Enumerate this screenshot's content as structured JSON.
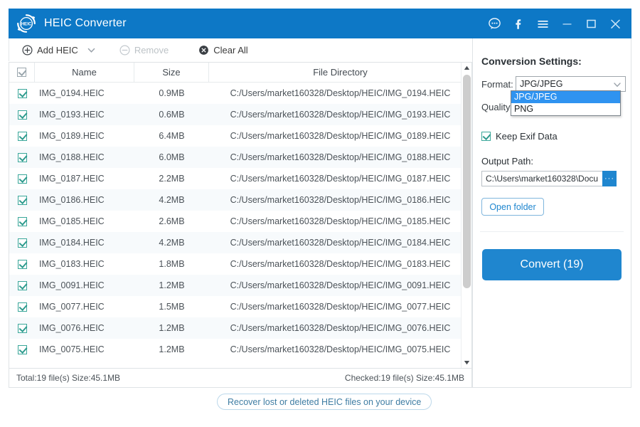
{
  "window": {
    "title": "HEIC Converter",
    "logo_text": "HEIC",
    "accent_color": "#0d78c6",
    "titlebar_buttons": [
      {
        "name": "feedback-icon",
        "label": "Feedback"
      },
      {
        "name": "facebook-icon",
        "label": "f"
      },
      {
        "name": "menu-icon",
        "label": "Menu"
      },
      {
        "name": "minimize-icon",
        "label": "Minimize"
      },
      {
        "name": "maximize-icon",
        "label": "Maximize"
      },
      {
        "name": "close-icon",
        "label": "Close"
      }
    ]
  },
  "toolbar": {
    "add_label": "Add HEIC",
    "remove_label": "Remove",
    "clear_label": "Clear All"
  },
  "table": {
    "headers": {
      "name": "Name",
      "size": "Size",
      "directory": "File Directory"
    },
    "rows": [
      {
        "checked": true,
        "name": "IMG_0194.HEIC",
        "size": "0.9MB",
        "dir": "C:/Users/market160328/Desktop/HEIC/IMG_0194.HEIC"
      },
      {
        "checked": true,
        "name": "IMG_0193.HEIC",
        "size": "0.6MB",
        "dir": "C:/Users/market160328/Desktop/HEIC/IMG_0193.HEIC"
      },
      {
        "checked": true,
        "name": "IMG_0189.HEIC",
        "size": "6.4MB",
        "dir": "C:/Users/market160328/Desktop/HEIC/IMG_0189.HEIC"
      },
      {
        "checked": true,
        "name": "IMG_0188.HEIC",
        "size": "6.0MB",
        "dir": "C:/Users/market160328/Desktop/HEIC/IMG_0188.HEIC"
      },
      {
        "checked": true,
        "name": "IMG_0187.HEIC",
        "size": "2.2MB",
        "dir": "C:/Users/market160328/Desktop/HEIC/IMG_0187.HEIC"
      },
      {
        "checked": true,
        "name": "IMG_0186.HEIC",
        "size": "4.2MB",
        "dir": "C:/Users/market160328/Desktop/HEIC/IMG_0186.HEIC"
      },
      {
        "checked": true,
        "name": "IMG_0185.HEIC",
        "size": "2.6MB",
        "dir": "C:/Users/market160328/Desktop/HEIC/IMG_0185.HEIC"
      },
      {
        "checked": true,
        "name": "IMG_0184.HEIC",
        "size": "4.2MB",
        "dir": "C:/Users/market160328/Desktop/HEIC/IMG_0184.HEIC"
      },
      {
        "checked": true,
        "name": "IMG_0183.HEIC",
        "size": "1.8MB",
        "dir": "C:/Users/market160328/Desktop/HEIC/IMG_0183.HEIC"
      },
      {
        "checked": true,
        "name": "IMG_0091.HEIC",
        "size": "1.2MB",
        "dir": "C:/Users/market160328/Desktop/HEIC/IMG_0091.HEIC"
      },
      {
        "checked": true,
        "name": "IMG_0077.HEIC",
        "size": "1.5MB",
        "dir": "C:/Users/market160328/Desktop/HEIC/IMG_0077.HEIC"
      },
      {
        "checked": true,
        "name": "IMG_0076.HEIC",
        "size": "1.2MB",
        "dir": "C:/Users/market160328/Desktop/HEIC/IMG_0076.HEIC"
      },
      {
        "checked": true,
        "name": "IMG_0075.HEIC",
        "size": "1.2MB",
        "dir": "C:/Users/market160328/Desktop/HEIC/IMG_0075.HEIC"
      }
    ]
  },
  "status": {
    "total": "Total:19 file(s) Size:45.1MB",
    "checked": "Checked:19 file(s) Size:45.1MB"
  },
  "settings": {
    "title": "Conversion Settings:",
    "format_label": "Format:",
    "format_value": "JPG/JPEG",
    "format_options": [
      "JPG/JPEG",
      "PNG"
    ],
    "format_selected_index": 0,
    "quality_label": "Quality:",
    "exif_label": "Keep Exif Data",
    "exif_checked": true,
    "output_label": "Output Path:",
    "output_value": "C:\\Users\\market160328\\Docu",
    "browse_label": "···",
    "open_folder_label": "Open folder",
    "convert_label": "Convert (19)",
    "convert_color": "#1f86cf"
  },
  "footer": {
    "recover_label": "Recover lost or deleted HEIC files on your device"
  }
}
